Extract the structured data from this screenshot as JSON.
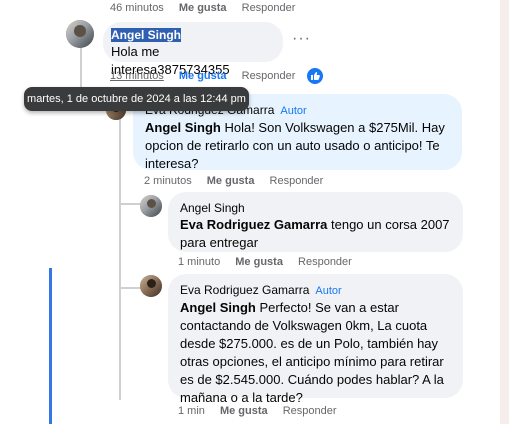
{
  "top_actions": {
    "time": "46 minutos",
    "like": "Me gusta",
    "reply": "Responder"
  },
  "comment1": {
    "author": "Angel Singh",
    "text": "Hola me interesa3875734355",
    "time": "13 minutos",
    "like": "Me gusta",
    "reply": "Responder",
    "more": "···"
  },
  "tooltip": {
    "text": "martes, 1 de octubre de 2024 a las 12:44 pm"
  },
  "reply1": {
    "author": "Eva Rodriguez Gamarra",
    "badge": "Autor",
    "mention": "Angel Singh",
    "text": " Hola! Son Volkswagen a $275Mil. Hay opcion de retirarlo con un auto usado o anticipo! Te interesa?",
    "time": "2 minutos",
    "like": "Me gusta",
    "reply": "Responder"
  },
  "reply2": {
    "author": "Angel Singh",
    "mention": "Eva Rodriguez Gamarra",
    "text": " tengo un corsa 2007 para entregar",
    "time": "1 minuto",
    "like": "Me gusta",
    "reply": "Responder"
  },
  "reply3": {
    "author": "Eva Rodriguez Gamarra",
    "badge": "Autor",
    "mention": "Angel Singh",
    "text": " Perfecto! Se van a estar contactando de Volkswagen 0km, La cuota desde $275.000. es de un Polo, también hay otras opciones, el anticipo mínimo para retirar es de $2.545.000. Cuándo podes hablar? A la mañana o a la tarde?",
    "time": "1 min",
    "like": "Me gusta",
    "reply": "Responder"
  },
  "colors": {
    "accent": "#1877f2",
    "bubble": "#f0f2f5",
    "author_bubble": "#e7f3ff",
    "selection": "#2f5fb0"
  }
}
